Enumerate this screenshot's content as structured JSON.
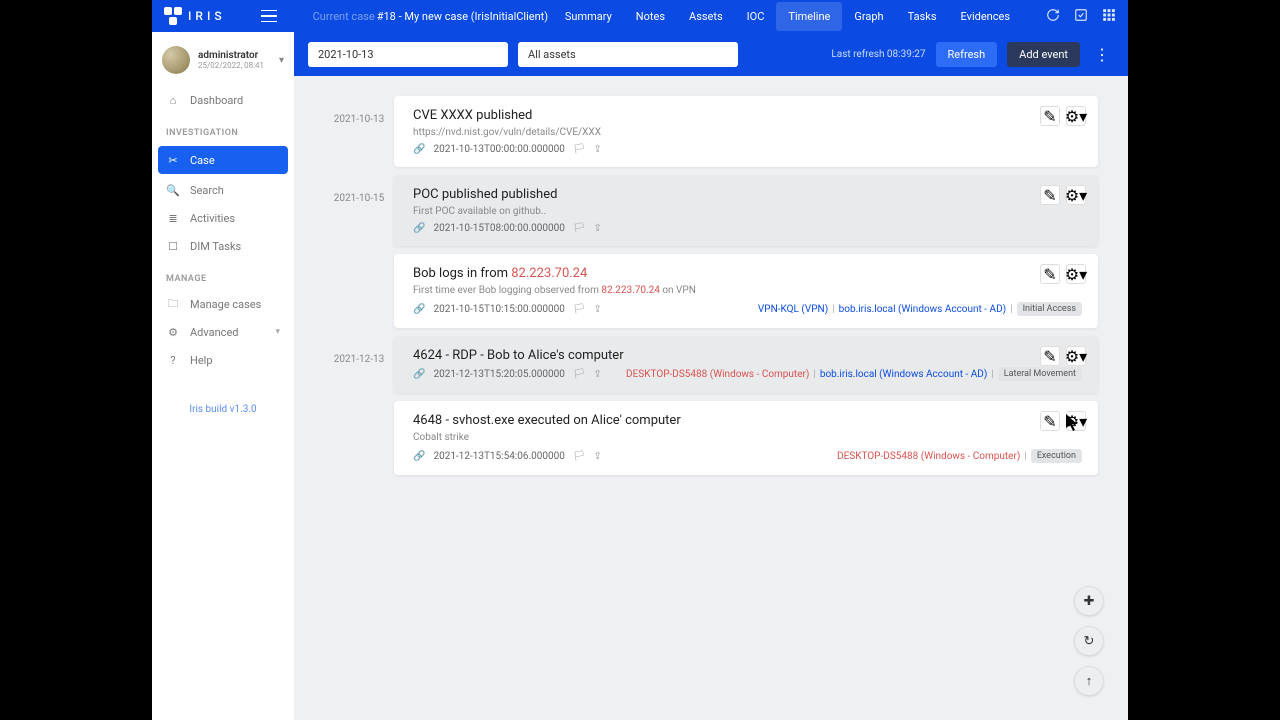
{
  "brand": "IRIS",
  "current_case_label": "Current case",
  "current_case": "#18 - My new case (IrisInitialClient)",
  "topnav": [
    "Summary",
    "Notes",
    "Assets",
    "IOC",
    "Timeline",
    "Graph",
    "Tasks",
    "Evidences"
  ],
  "topnav_active": 4,
  "user": {
    "name": "administrator",
    "sub": "25/02/2022, 08:41"
  },
  "sidebar": {
    "dashboard": "Dashboard",
    "section1": "INVESTIGATION",
    "case": "Case",
    "search": "Search",
    "activities": "Activities",
    "dimtasks": "DIM Tasks",
    "section2": "MANAGE",
    "managecases": "Manage cases",
    "advanced": "Advanced",
    "help": "Help",
    "build": "Iris build v1.3.0"
  },
  "toolbar": {
    "date": "2021-10-13",
    "assets": "All assets",
    "last_refresh": "Last refresh 08:39:27",
    "refresh": "Refresh",
    "add": "Add event"
  },
  "dates": [
    "2021-10-13",
    "2021-10-15",
    "2021-12-13"
  ],
  "events": {
    "g0": [
      {
        "title": "CVE XXXX published",
        "sub": "https://nvd.nist.gov/vuln/details/CVE/XXX",
        "ts": "2021-10-13T00:00:00.000000",
        "grey": false
      }
    ],
    "g1": [
      {
        "title": "POC published published",
        "sub": "First POC available on github..",
        "ts": "2021-10-15T08:00:00.000000",
        "grey": true
      },
      {
        "title": "Bob logs in from ",
        "ip": "82.223.70.24",
        "sub": "First time ever Bob logging observed from  ",
        "subip": "82.223.70.24",
        "subafter": " on VPN",
        "ts": "2021-10-15T10:15:00.000000",
        "tags": {
          "vpn": "VPN-KQL (VPN)",
          "acct": "bob.iris.local (Windows Account - AD)",
          "cat": "Initial Access"
        }
      }
    ],
    "g2": [
      {
        "title": "4624 - RDP - Bob to Alice's computer",
        "ts": "2021-12-13T15:20:05.000000",
        "grey": true,
        "tags": {
          "asset": "DESKTOP-DS5488 (Windows - Computer)",
          "acct": "bob.iris.local (Windows Account - AD)",
          "cat": "Lateral Movement"
        }
      },
      {
        "title": "4648 - svhost.exe executed on Alice' computer",
        "sub": "Cobalt strike",
        "ts": "2021-12-13T15:54:06.000000",
        "tags": {
          "asset": "DESKTOP-DS5488 (Windows - Computer)",
          "cat": "Execution"
        }
      }
    ]
  }
}
